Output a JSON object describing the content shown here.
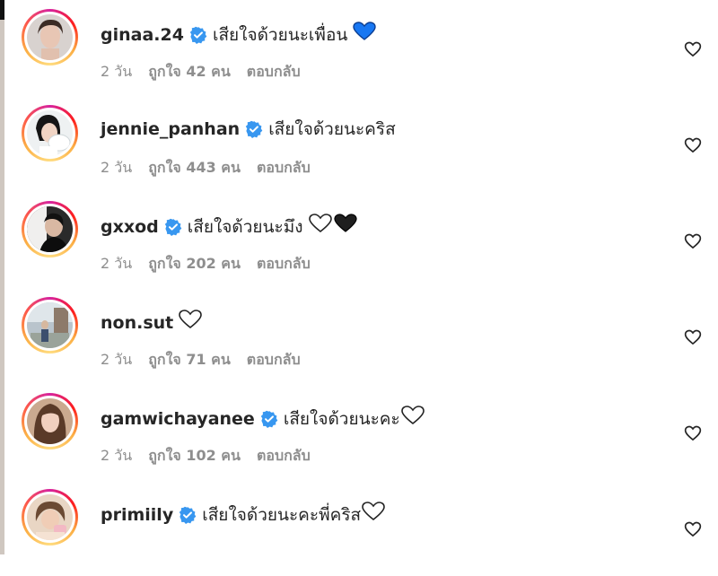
{
  "comments": [
    {
      "username": "ginaa.24",
      "text": "เสียใจด้วยนะเพื่อน",
      "emoji": "blue-heart-icon",
      "time": "2 วัน",
      "likes": "ถูกใจ 42 คน",
      "reply": "ตอบกลับ"
    },
    {
      "username": "jennie_panhan",
      "text": "เสียใจด้วยนะคริส",
      "emoji": "",
      "time": "2 วัน",
      "likes": "ถูกใจ 443 คน",
      "reply": "ตอบกลับ"
    },
    {
      "username": "gxxod",
      "text": "เสียใจด้วยนะมึง",
      "emoji": "white-and-black-heart-icons",
      "time": "2 วัน",
      "likes": "ถูกใจ 202 คน",
      "reply": "ตอบกลับ"
    },
    {
      "username": "non.sut",
      "text": "",
      "emoji": "white-heart-icon",
      "time": "2 วัน",
      "likes": "ถูกใจ 71 คน",
      "reply": "ตอบกลับ"
    },
    {
      "username": "gamwichayanee",
      "text": "เสียใจด้วยนะคะ",
      "emoji": "white-heart-icon",
      "time": "2 วัน",
      "likes": "ถูกใจ 102 คน",
      "reply": "ตอบกลับ"
    },
    {
      "username": "primiily",
      "text": "เสียใจด้วยนะคะพี่คริส",
      "emoji": "white-heart-icon",
      "time": "",
      "likes": "",
      "reply": ""
    }
  ],
  "colors": {
    "verified": "#3897f0",
    "blue_heart": "#1877f2",
    "ring_start": "#d6249f",
    "ring_end": "#fcaf45"
  }
}
